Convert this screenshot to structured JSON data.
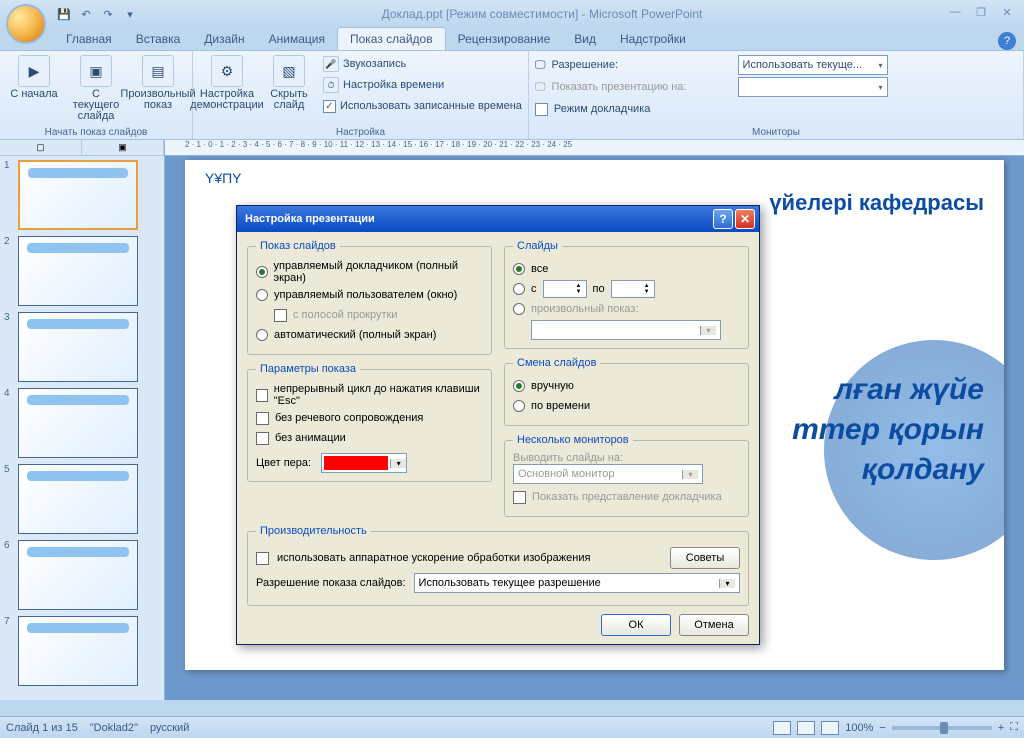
{
  "app": {
    "title": "Доклад.ppt [Режим совместимости] - Microsoft PowerPoint"
  },
  "tabs": [
    "Главная",
    "Вставка",
    "Дизайн",
    "Анимация",
    "Показ слайдов",
    "Рецензирование",
    "Вид",
    "Надстройки"
  ],
  "active_tab": "Показ слайдов",
  "ribbon": {
    "group1": {
      "label": "Начать показ слайдов",
      "btn1": "С начала",
      "btn2": "С текущего слайда",
      "btn3": "Произвольный показ"
    },
    "group2": {
      "label": "Настройка",
      "btn1": "Настройка демонстрации",
      "btn2": "Скрыть слайд",
      "item1": "Звукозапись",
      "item2": "Настройка времени",
      "item3": "Использовать записанные времена"
    },
    "group3": {
      "label": "Мониторы",
      "row1_label": "Разрешение:",
      "row1_value": "Использовать текуще...",
      "row2_label": "Показать презентацию на:",
      "row2_value": "",
      "row3_label": "Режим докладчика"
    }
  },
  "thumb_header": [
    "▢",
    "▣"
  ],
  "dialog": {
    "title": "Настройка презентации",
    "show_slides": {
      "legend": "Показ слайдов",
      "opt1": "управляемый докладчиком (полный экран)",
      "opt2": "управляемый пользователем (окно)",
      "opt2_sub": "с полосой прокрутки",
      "opt3": "автоматический (полный экран)"
    },
    "params": {
      "legend": "Параметры показа",
      "chk1": "непрерывный цикл до нажатия клавиши \"Esc\"",
      "chk2": "без речевого сопровождения",
      "chk3": "без анимации",
      "pen_label": "Цвет пера:"
    },
    "slides": {
      "legend": "Слайды",
      "opt1": "все",
      "opt2_from": "с",
      "opt2_to": "по",
      "opt3": "произвольный показ:"
    },
    "change": {
      "legend": "Смена слайдов",
      "opt1": "вручную",
      "opt2": "по времени"
    },
    "monitors": {
      "legend": "Несколько мониторов",
      "label1": "Выводить слайды на:",
      "value1": "Основной монитор",
      "chk1": "Показать представление докладчика"
    },
    "perf": {
      "legend": "Производительность",
      "chk1": "использовать аппаратное ускорение обработки изображения",
      "btn_tips": "Советы",
      "res_label": "Разрешение показа слайдов:",
      "res_value": "Использовать текущее разрешение"
    },
    "btn_ok": "ОК",
    "btn_cancel": "Отмена",
    "pen_color": "#FF0000"
  },
  "slide": {
    "logo": "Y¥ПY",
    "title_right": "үйелері кафедрасы",
    "body": "лған жүйе\nттер қорын\nқолдану"
  },
  "ruler": "2 · 1 · 0 · 1 · 2 · 3 · 4 · 5 · 6 · 7 · 8 · 9 · 10 · 11 · 12 · 13 · 14 · 15 · 16 · 17 · 18 · 19 · 20 · 21 · 22 · 23 · 24 · 25",
  "status": {
    "left1": "Слайд 1 из 15",
    "left2": "\"Doklad2\"",
    "left3": "русский",
    "zoom": "100%"
  }
}
